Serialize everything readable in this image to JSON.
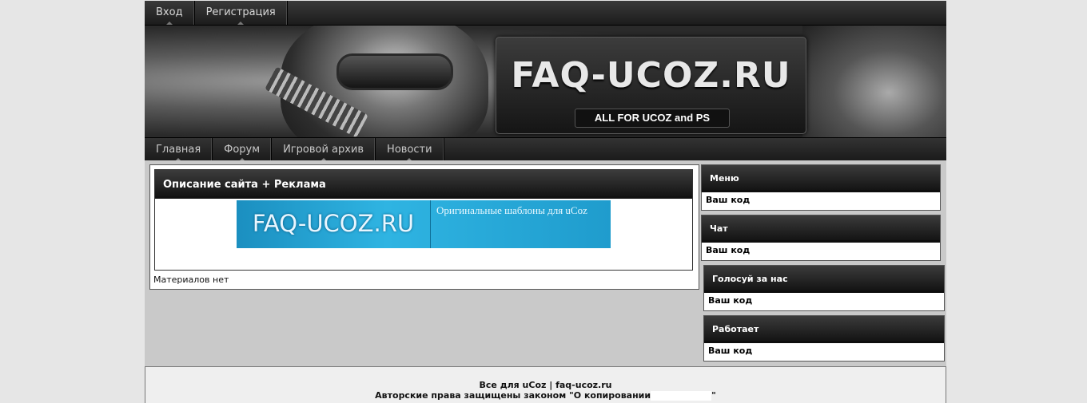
{
  "topbar": {
    "items": [
      "Вход",
      "Регистрация"
    ]
  },
  "banner": {
    "logo_title": "FAQ-UCOZ.RU",
    "logo_subtitle": "ALL FOR UCOZ and PS"
  },
  "nav": {
    "items": [
      "Главная",
      "Форум",
      "Игровой архив",
      "Новости"
    ]
  },
  "main": {
    "block_title": "Описание сайта + Реклама",
    "ad": {
      "logo": "FAQ-UCOZ.RU",
      "text": "Оригинальные шаблоны для uCoz"
    },
    "materials_text": "Материалов нет"
  },
  "sidebar": {
    "blocks": [
      {
        "title": "Меню",
        "body": "Ваш код"
      },
      {
        "title": "Чат",
        "body": "Ваш код"
      },
      {
        "title": "Голосуй за нас",
        "body": "Ваш код"
      },
      {
        "title": "Работает",
        "body": "Ваш код"
      }
    ]
  },
  "footer": {
    "line1": "Все для uCoz | faq-ucoz.ru",
    "line2": "Авторские права защищены законом \"О копировании",
    "line2_end": "\""
  }
}
